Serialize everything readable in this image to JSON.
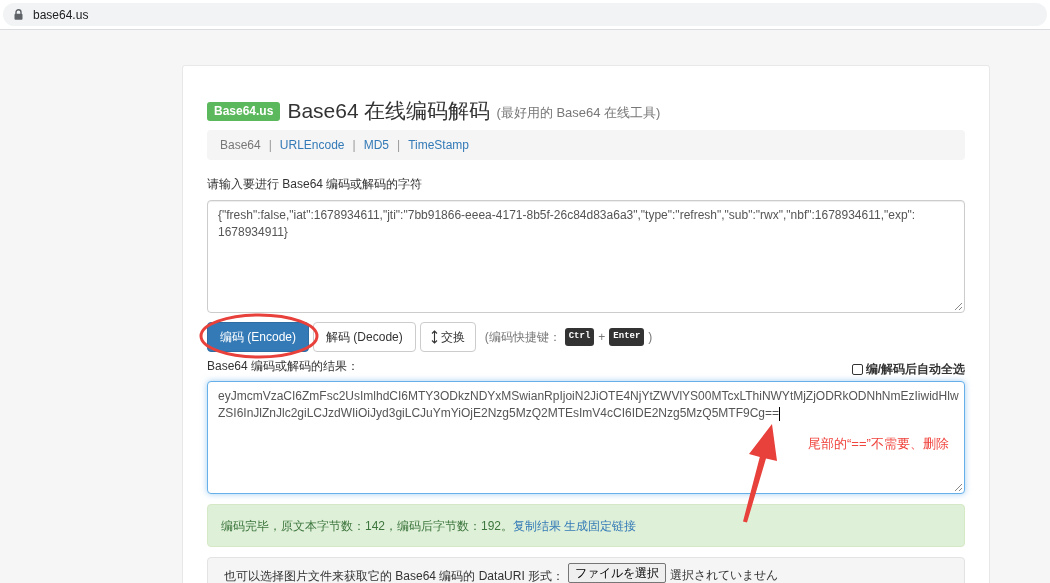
{
  "browser": {
    "address": "base64.us"
  },
  "header": {
    "badge": "Base64.us",
    "title": "Base64 在线编码解码",
    "subtitle": "(最好用的 Base64 在线工具)"
  },
  "nav": {
    "separator": "|",
    "items": [
      {
        "label": "Base64",
        "selected": true
      },
      {
        "label": "URLEncode",
        "selected": false
      },
      {
        "label": "MD5",
        "selected": false
      },
      {
        "label": "TimeStamp",
        "selected": false
      }
    ]
  },
  "input": {
    "label": "请输入要进行 Base64 编码或解码的字符",
    "value": "{\"fresh\":false,\"iat\":1678934611,\"jti\":\"7bb91866-eeea-4171-8b5f-26c84d83a6a3\",\"type\":\"refresh\",\"sub\":\"rwx\",\"nbf\":1678934611,\"exp\": 1678934911}",
    "focused": false
  },
  "buttons": [
    {
      "label": "编码 (Encode)",
      "kind": "primary"
    },
    {
      "label": "解码 (Decode)",
      "kind": "default"
    },
    {
      "label": "交换",
      "kind": "swap"
    }
  ],
  "shortcut": {
    "prefix": "(编码快捷键：",
    "keys": [
      "Ctrl",
      "Enter"
    ],
    "joiner": "+",
    "suffix": ")"
  },
  "output": {
    "label": "Base64 编码或解码的结果：",
    "auto_select": {
      "label": "编/解码后自动全选",
      "checked": false
    },
    "value": "eyJmcmVzaCI6ZmFsc2UsImlhdCI6MTY3ODkzNDYxMSwianRpIjoiN2JiOTE4NjYtZWVlYS00MTcxLThiNWYtMjZjODRkODNhNmEzIiwidHlwZSI6InJlZnJlc2giLCJzdWIiOiJyd3giLCJuYmYiOjE2Nzg5MzQ2MTEsImV4cCI6IDE2Nzg5MzQ5MTF9Cg==",
    "focused": true
  },
  "status": {
    "message": "编码完毕，原文本字节数：142，编码后字节数：192。",
    "links": [
      "复制结果",
      "生成固定链接"
    ]
  },
  "file_picker": {
    "label": "也可以选择图片文件来获取它的 Base64 编码的 DataURI 形式：",
    "button": "ファイルを選択",
    "status": "選択されていません"
  },
  "annotations": [
    {
      "kind": "ellipse"
    },
    {
      "kind": "arrow"
    },
    {
      "kind": "note",
      "text": "尾部的“==”不需要、删除"
    }
  ]
}
